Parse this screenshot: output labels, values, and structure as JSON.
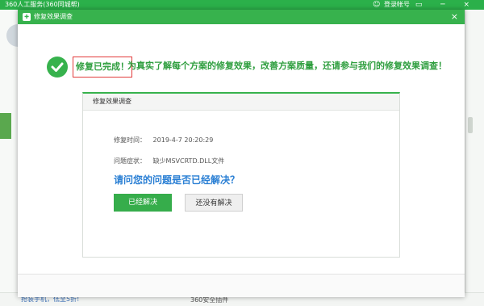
{
  "background": {
    "title": "360人工服务(360同城帮)",
    "login_label": "登录帐号",
    "window_controls": "▭ ─ ×",
    "bottom_left": "抢装手机，低至5折!",
    "bottom_mid": "360安全插件"
  },
  "dialog": {
    "title": "修复效果调查",
    "close_label": "×",
    "done_label": "修复已完成！",
    "message": "为真实了解每个方案的修复效果，改善方案质量，还请参与我们的修复效果调查！",
    "card": {
      "header": "修复效果调查",
      "time_label": "修复时间：",
      "time_value": "2019-4-7 20:20:29",
      "symptom_label": "问题症状：",
      "symptom_value": "缺少MSVCRTD.DLL文件",
      "question": "请问您的问题是否已经解决？",
      "yes_button": "已经解决",
      "no_button": "还没有解决"
    }
  },
  "colors": {
    "brand_green": "#37b24d",
    "highlight_red": "#e23b3b",
    "question_blue": "#2a7fd4"
  }
}
